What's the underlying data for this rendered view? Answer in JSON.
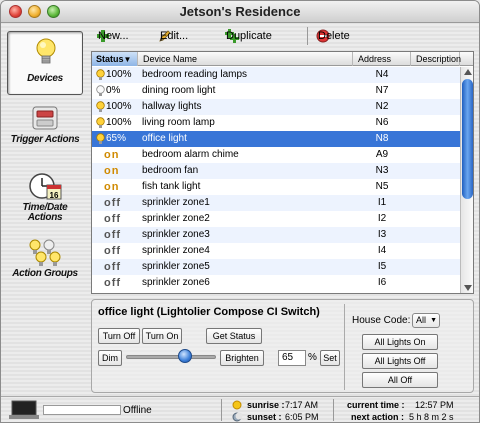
{
  "window": {
    "title": "Jetson's Residence"
  },
  "sidebar": {
    "items": [
      {
        "label": "Devices",
        "icon": "lightbulb-icon"
      },
      {
        "label": "Trigger Actions",
        "icon": "trigger-icon"
      },
      {
        "label": "Time/Date Actions",
        "icon": "clock-calendar-icon"
      },
      {
        "label": "Action Groups",
        "icon": "bulb-group-icon"
      }
    ]
  },
  "toolbar": {
    "new_label": "New...",
    "edit_label": "Edit...",
    "duplicate_label": "Duplicate",
    "delete_label": "Delete"
  },
  "table": {
    "columns": [
      "Status",
      "Device Name",
      "Address",
      "Description"
    ],
    "rows": [
      {
        "status": "100%",
        "name": "bedroom reading lamps",
        "address": "N4",
        "description": ""
      },
      {
        "status": "0%",
        "name": "dining room light",
        "address": "N7",
        "description": ""
      },
      {
        "status": "100%",
        "name": "hallway lights",
        "address": "N2",
        "description": ""
      },
      {
        "status": "100%",
        "name": "living room lamp",
        "address": "N6",
        "description": ""
      },
      {
        "status": "65%",
        "name": "office light",
        "address": "N8",
        "description": ""
      },
      {
        "status": "on",
        "name": "bedroom alarm chime",
        "address": "A9",
        "description": ""
      },
      {
        "status": "on",
        "name": "bedroom fan",
        "address": "N3",
        "description": ""
      },
      {
        "status": "on",
        "name": "fish tank light",
        "address": "N5",
        "description": ""
      },
      {
        "status": "off",
        "name": "sprinkler zone1",
        "address": "I1",
        "description": ""
      },
      {
        "status": "off",
        "name": "sprinkler zone2",
        "address": "I2",
        "description": ""
      },
      {
        "status": "off",
        "name": "sprinkler zone3",
        "address": "I3",
        "description": ""
      },
      {
        "status": "off",
        "name": "sprinkler zone4",
        "address": "I4",
        "description": ""
      },
      {
        "status": "off",
        "name": "sprinkler zone5",
        "address": "I5",
        "description": ""
      },
      {
        "status": "off",
        "name": "sprinkler zone6",
        "address": "I6",
        "description": ""
      }
    ],
    "selected_index": 4
  },
  "panel": {
    "title": "office light (Lightolier Compose CI Switch)",
    "turn_off_label": "Turn Off",
    "turn_on_label": "Turn On",
    "get_status_label": "Get Status",
    "dim_label": "Dim",
    "brighten_label": "Brighten",
    "level_value": "65",
    "percent_label": "%",
    "set_label": "Set",
    "brightness_level": 0.65,
    "house_code_label": "House Code:",
    "house_code_value": "All",
    "all_lights_on_label": "All Lights On",
    "all_lights_off_label": "All Lights Off",
    "all_off_label": "All Off"
  },
  "statusbar": {
    "connection": "Offline",
    "sunrise_label": "sunrise :",
    "sunrise_value": "7:17 AM",
    "sunset_label": "sunset :",
    "sunset_value": "6:05 PM",
    "current_time_label": "current time :",
    "current_time_value": "12:57 PM",
    "next_action_label": "next action :",
    "next_action_value": "5 h 8 m 2 s"
  },
  "colors": {
    "selection": "#3875d7",
    "on_status": "#d08a00",
    "alt_row": "#edf3fe"
  }
}
